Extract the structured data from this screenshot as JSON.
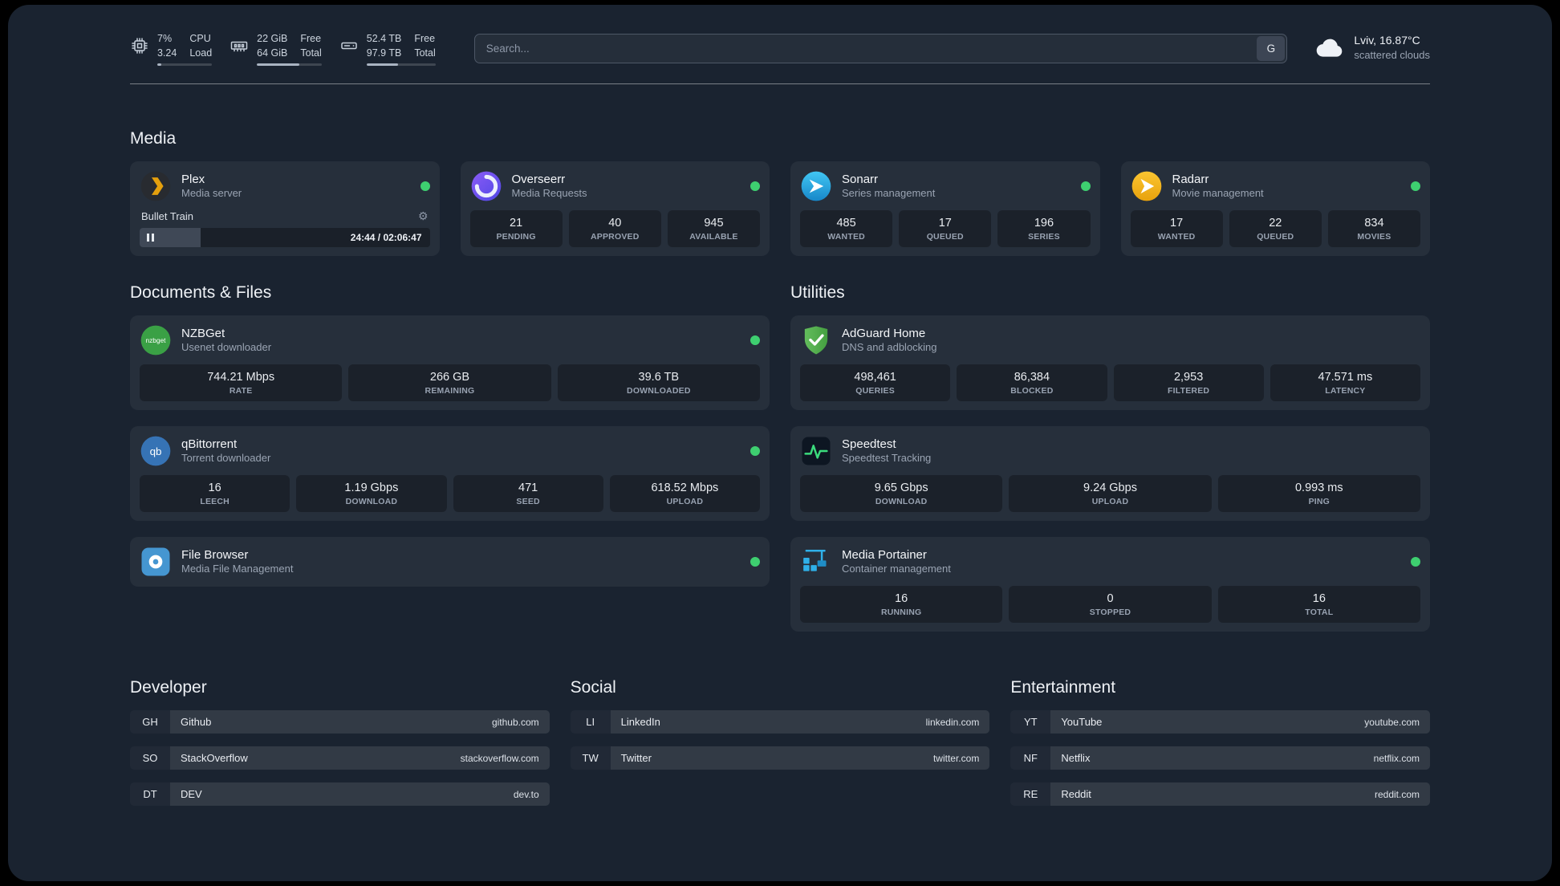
{
  "topbar": {
    "resources": [
      {
        "icon": "cpu-icon",
        "value_top": "7%",
        "value_bottom": "3.24",
        "label_top": "CPU",
        "label_bottom": "Load",
        "progress": 7
      },
      {
        "icon": "memory-icon",
        "value_top": "22 GiB",
        "value_bottom": "64 GiB",
        "label_top": "Free",
        "label_bottom": "Total",
        "progress": 66
      },
      {
        "icon": "disk-icon",
        "value_top": "52.4 TB",
        "value_bottom": "97.9 TB",
        "label_top": "Free",
        "label_bottom": "Total",
        "progress": 46
      }
    ],
    "search": {
      "placeholder": "Search...",
      "provider": "G"
    },
    "weather": {
      "icon": "cloud-icon",
      "location": "Lviv, 16.87°C",
      "condition": "scattered clouds"
    }
  },
  "media": {
    "title": "Media",
    "cards": [
      {
        "name": "Plex",
        "desc": "Media server",
        "status": "online",
        "player": {
          "track": "Bullet Train",
          "time": "24:44 / 02:06:47",
          "progress": 21
        }
      },
      {
        "name": "Overseerr",
        "desc": "Media Requests",
        "status": "online",
        "stats": [
          {
            "value": "21",
            "label": "PENDING"
          },
          {
            "value": "40",
            "label": "APPROVED"
          },
          {
            "value": "945",
            "label": "AVAILABLE"
          }
        ]
      },
      {
        "name": "Sonarr",
        "desc": "Series management",
        "status": "online",
        "stats": [
          {
            "value": "485",
            "label": "WANTED"
          },
          {
            "value": "17",
            "label": "QUEUED"
          },
          {
            "value": "196",
            "label": "SERIES"
          }
        ]
      },
      {
        "name": "Radarr",
        "desc": "Movie management",
        "status": "online",
        "stats": [
          {
            "value": "17",
            "label": "WANTED"
          },
          {
            "value": "22",
            "label": "QUEUED"
          },
          {
            "value": "834",
            "label": "MOVIES"
          }
        ]
      }
    ]
  },
  "documents": {
    "title": "Documents & Files",
    "cards": [
      {
        "name": "NZBGet",
        "desc": "Usenet downloader",
        "status": "online",
        "stats": [
          {
            "value": "744.21 Mbps",
            "label": "RATE"
          },
          {
            "value": "266 GB",
            "label": "REMAINING"
          },
          {
            "value": "39.6 TB",
            "label": "DOWNLOADED"
          }
        ]
      },
      {
        "name": "qBittorrent",
        "desc": "Torrent downloader",
        "status": "online",
        "stats": [
          {
            "value": "16",
            "label": "LEECH"
          },
          {
            "value": "1.19 Gbps",
            "label": "DOWNLOAD"
          },
          {
            "value": "471",
            "label": "SEED"
          },
          {
            "value": "618.52 Mbps",
            "label": "UPLOAD"
          }
        ]
      },
      {
        "name": "File Browser",
        "desc": "Media File Management",
        "status": "online"
      }
    ]
  },
  "utilities": {
    "title": "Utilities",
    "cards": [
      {
        "name": "AdGuard Home",
        "desc": "DNS and adblocking",
        "stats": [
          {
            "value": "498,461",
            "label": "QUERIES"
          },
          {
            "value": "86,384",
            "label": "BLOCKED"
          },
          {
            "value": "2,953",
            "label": "FILTERED"
          },
          {
            "value": "47.571 ms",
            "label": "LATENCY"
          }
        ]
      },
      {
        "name": "Speedtest",
        "desc": "Speedtest Tracking",
        "stats": [
          {
            "value": "9.65 Gbps",
            "label": "DOWNLOAD"
          },
          {
            "value": "9.24 Gbps",
            "label": "UPLOAD"
          },
          {
            "value": "0.993 ms",
            "label": "PING"
          }
        ]
      },
      {
        "name": "Media Portainer",
        "desc": "Container management",
        "status": "online",
        "stats": [
          {
            "value": "16",
            "label": "RUNNING"
          },
          {
            "value": "0",
            "label": "STOPPED"
          },
          {
            "value": "16",
            "label": "TOTAL"
          }
        ]
      }
    ]
  },
  "bookmarks": {
    "groups": [
      {
        "title": "Developer",
        "items": [
          {
            "abbr": "GH",
            "name": "Github",
            "domain": "github.com"
          },
          {
            "abbr": "SO",
            "name": "StackOverflow",
            "domain": "stackoverflow.com"
          },
          {
            "abbr": "DT",
            "name": "DEV",
            "domain": "dev.to"
          }
        ]
      },
      {
        "title": "Social",
        "items": [
          {
            "abbr": "LI",
            "name": "LinkedIn",
            "domain": "linkedin.com"
          },
          {
            "abbr": "TW",
            "name": "Twitter",
            "domain": "twitter.com"
          }
        ]
      },
      {
        "title": "Entertainment",
        "items": [
          {
            "abbr": "YT",
            "name": "YouTube",
            "domain": "youtube.com"
          },
          {
            "abbr": "NF",
            "name": "Netflix",
            "domain": "netflix.com"
          },
          {
            "abbr": "RE",
            "name": "Reddit",
            "domain": "reddit.com"
          }
        ]
      }
    ]
  },
  "colors": {
    "status_online": "#3ecf70",
    "plex_accent": "#e5a00d",
    "background": "#1a2330"
  }
}
